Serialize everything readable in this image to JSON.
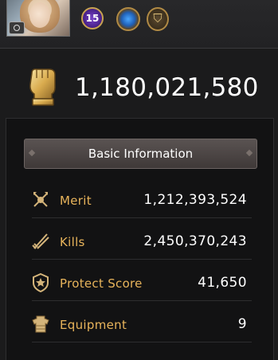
{
  "profile": {
    "level": "15",
    "power": "1,180,021,580"
  },
  "panel": {
    "header": "Basic Information",
    "stats": [
      {
        "label": "Merit",
        "value": "1,212,393,524",
        "icon": "merit-icon"
      },
      {
        "label": "Kills",
        "value": "2,450,370,243",
        "icon": "kills-icon"
      },
      {
        "label": "Protect Score",
        "value": "41,650",
        "icon": "shield-icon"
      },
      {
        "label": "Equipment",
        "value": "9",
        "icon": "armor-icon"
      }
    ]
  },
  "colors": {
    "accent": "#e8b45b",
    "background": "#1b1b1c"
  }
}
